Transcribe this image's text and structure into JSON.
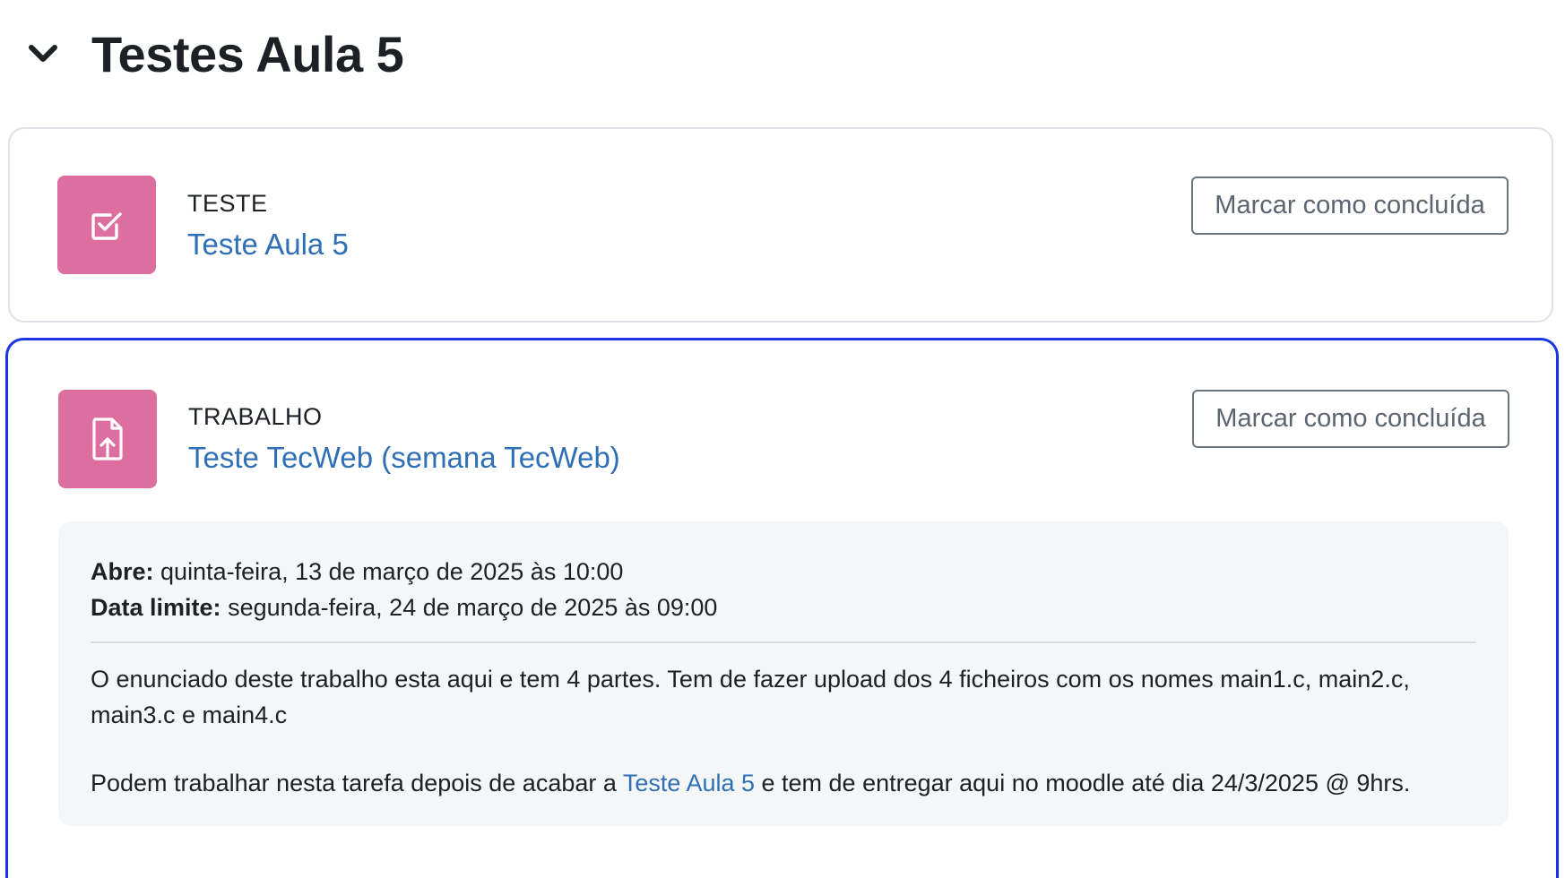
{
  "section": {
    "title": "Testes Aula 5"
  },
  "activities": [
    {
      "type_label": "TESTE",
      "name": "Teste Aula 5",
      "complete_button": "Marcar como concluída"
    },
    {
      "type_label": "TRABALHO",
      "name": "Teste TecWeb (semana TecWeb)",
      "complete_button": "Marcar como concluída",
      "dates": {
        "opens_label": "Abre:",
        "opens_value": "quinta-feira, 13 de março de 2025 às 10:00",
        "due_label": "Data limite:",
        "due_value": "segunda-feira, 24 de março de 2025 às 09:00"
      },
      "description": {
        "paragraph1": "O enunciado deste trabalho esta aqui e tem 4 partes. Tem de fazer upload dos 4 ficheiros com os nomes main1.c, main2.c, main3.c e main4.c",
        "paragraph2_before": "Podem trabalhar nesta tarefa depois de acabar a ",
        "paragraph2_link": "Teste Aula 5",
        "paragraph2_after": " e tem de entregar aqui no moodle até dia 24/3/2025 @ 9hrs."
      }
    }
  ],
  "icons": {
    "collapse": "chevron-down-icon",
    "quiz": "checkbox-icon",
    "assignment": "file-upload-icon"
  },
  "colors": {
    "icon_bg": "#dc6ea0",
    "link": "#2f6fb5",
    "focus_border": "#1a35e8"
  }
}
